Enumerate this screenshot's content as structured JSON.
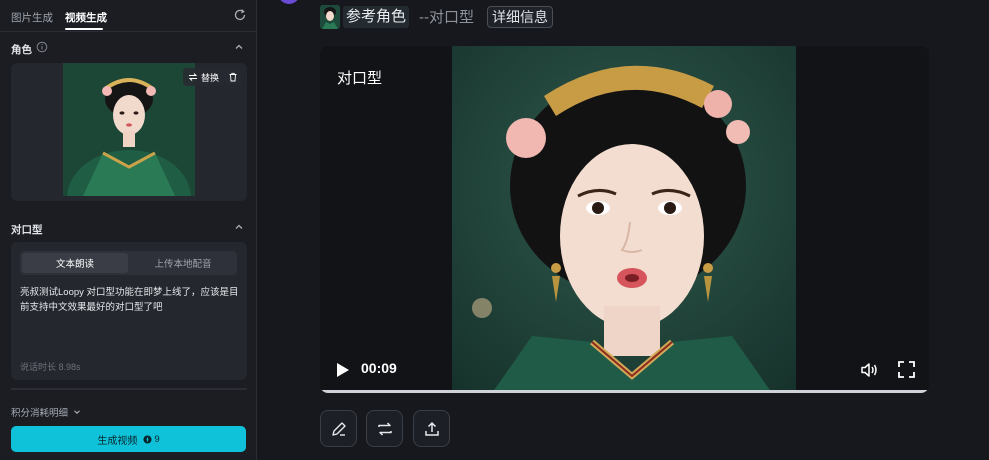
{
  "tabs": [
    {
      "label": "图片生成"
    },
    {
      "label": "视频生成"
    }
  ],
  "sidebar": {
    "role_section": {
      "title": "角色",
      "replace_label": "替换"
    },
    "lip_section": {
      "title": "对口型",
      "modes": [
        {
          "label": "文本朗读"
        },
        {
          "label": "上传本地配音"
        }
      ],
      "text": "亮叔测试Loopy 对口型功能在即梦上线了，应该是目前支持中文效果最好的对口型了吧",
      "duration": "说话时长 8.98s"
    },
    "points_label": "积分消耗明细",
    "generate": {
      "label": "生成视频",
      "cost": "9"
    }
  },
  "header": {
    "title": "参考角色",
    "subtitle": "--对口型",
    "detail_button": "详细信息"
  },
  "player": {
    "overlay_label": "对口型",
    "time": "00:09",
    "progress": 1.0
  },
  "icons": {
    "refresh": "refresh-icon",
    "info": "info-icon",
    "replace": "swap-icon",
    "delete": "trash-icon",
    "play": "play-icon",
    "volume": "volume-icon",
    "fullscreen": "fullscreen-icon",
    "edit": "edit-icon",
    "loop": "loop-icon",
    "share": "upload-icon"
  },
  "colors": {
    "accent": "#10c2d9",
    "panel": "#1b1d23",
    "card": "#24272e"
  }
}
